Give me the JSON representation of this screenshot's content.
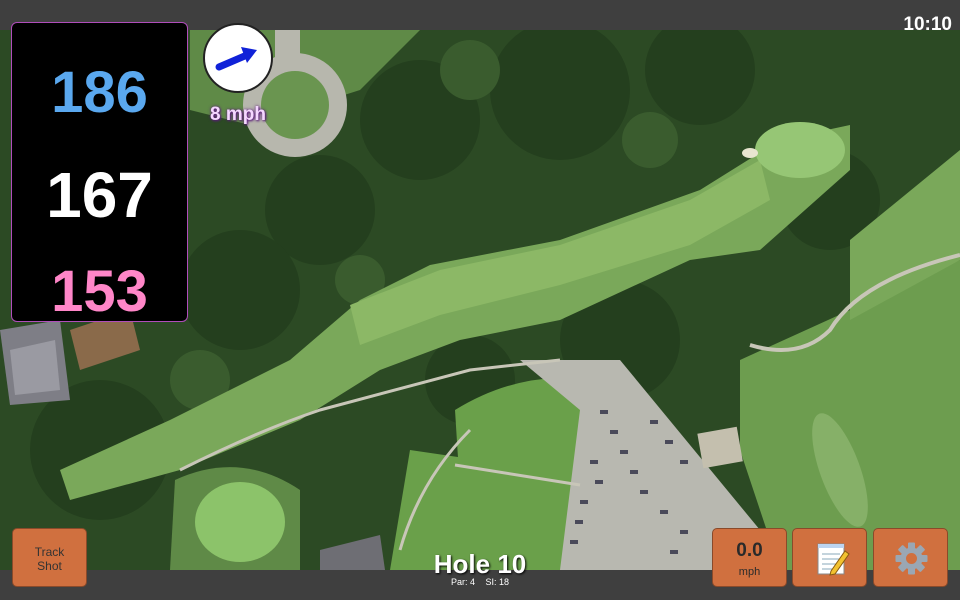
{
  "clock": "10:10",
  "distances": {
    "back": "186",
    "middle": "167",
    "front": "153"
  },
  "wind": {
    "speed_label": "8 mph"
  },
  "track_shot": {
    "line1": "Track",
    "line2": "Shot"
  },
  "speed": {
    "value": "0.0",
    "unit": "mph"
  },
  "hole": {
    "title": "Hole 10",
    "par": "Par: 4",
    "si": "SI: 18"
  },
  "icons": {
    "wind": "wind-arrow-icon",
    "notes": "notepad-icon",
    "settings": "gear-icon"
  },
  "colors": {
    "back": "#5aa8ef",
    "middle": "#ffffff",
    "front": "#ff86c8",
    "button": "#d0703f"
  }
}
